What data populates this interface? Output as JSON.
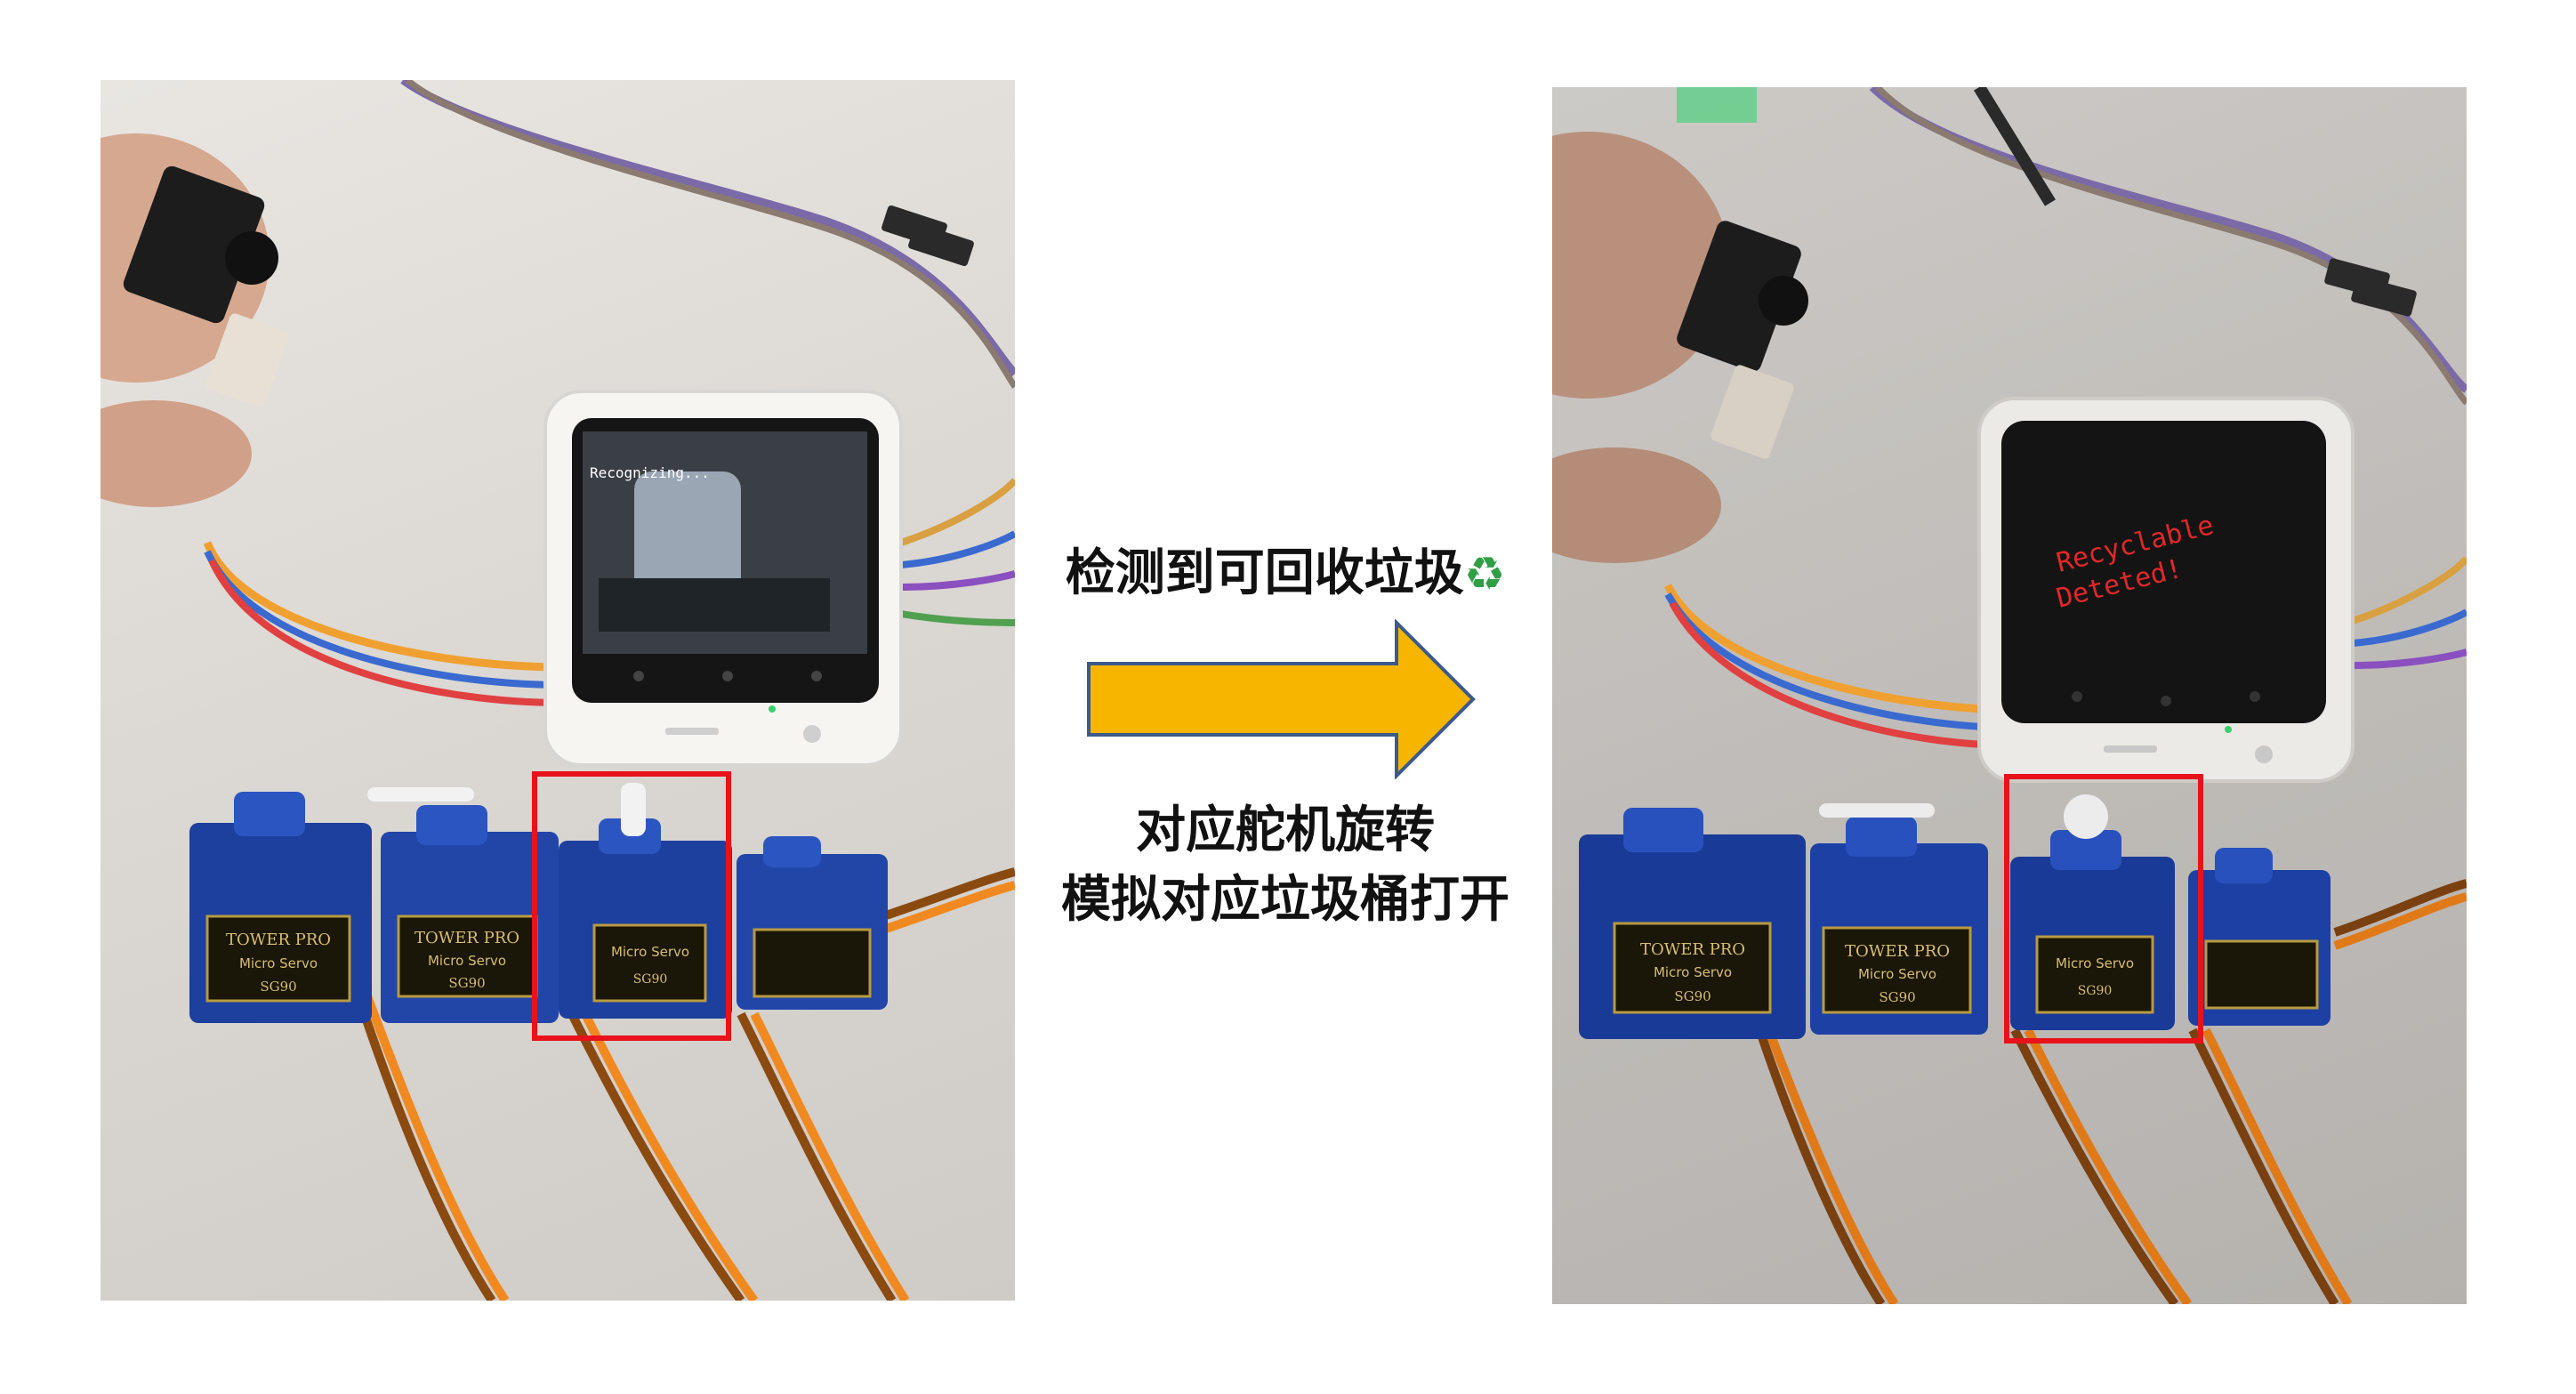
{
  "captions": {
    "detected_text": "检测到可回收垃圾",
    "recycle_symbol": "♻",
    "servo_line1": "对应舵机旋转",
    "servo_line2": "模拟对应垃圾桶打开"
  },
  "left_photo": {
    "screen_status": "Recognizing..."
  },
  "right_photo": {
    "screen_line1": "Recyclable",
    "screen_line2": "Deteted!"
  },
  "servo_labels": {
    "brand": "TOWER PRO",
    "model_line": "Micro Servo",
    "model": "SG90"
  },
  "colors": {
    "highlight_box": "#e8121b",
    "arrow_fill": "#f7b500",
    "arrow_stroke": "#3c5a8a",
    "servo_blue": "#1d3f9e",
    "screen_red_text": "#e0282a"
  }
}
